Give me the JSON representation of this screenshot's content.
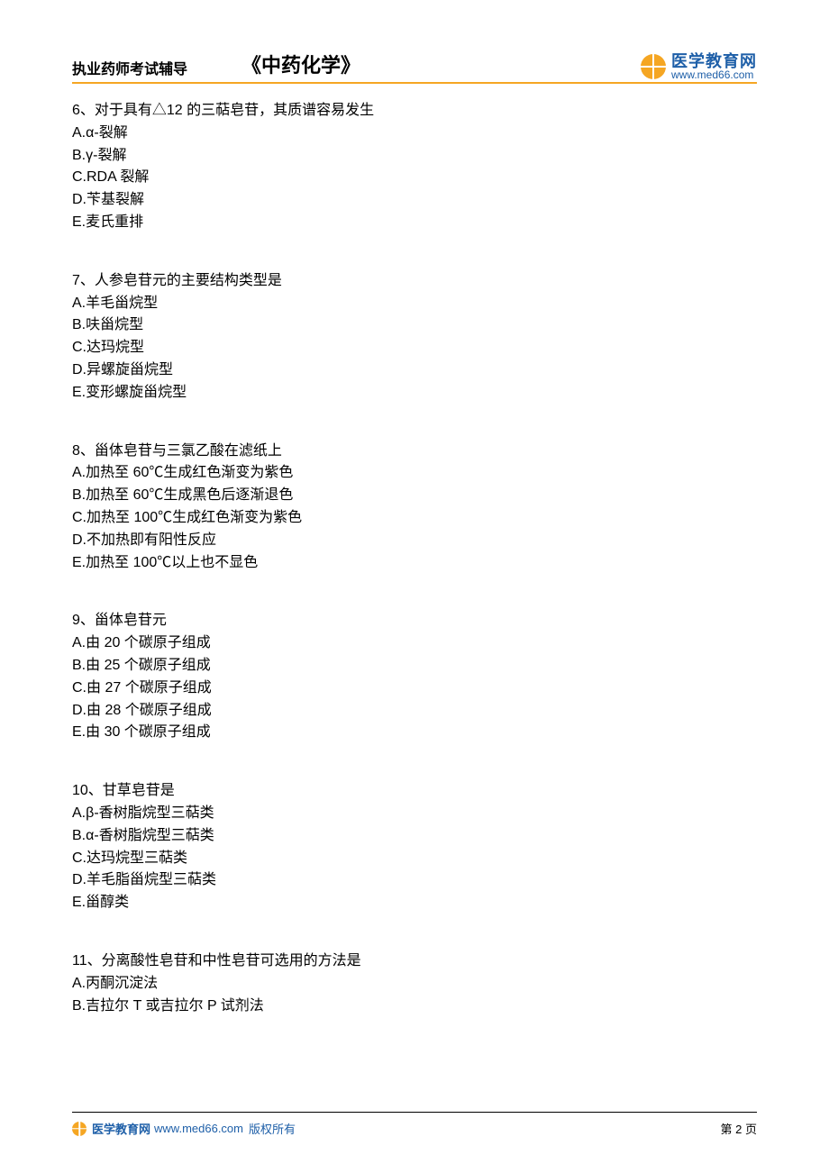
{
  "header": {
    "left": "执业药师考试辅导",
    "center": "《中药化学》",
    "logo_cn": "医学教育网",
    "logo_url": "www.med66.com"
  },
  "questions": [
    {
      "stem": "6、对于具有△12 的三萜皂苷，其质谱容易发生",
      "options": [
        "A.α-裂解",
        "B.γ-裂解",
        "C.RDA 裂解",
        "D.苄基裂解",
        "E.麦氏重排"
      ]
    },
    {
      "stem": "7、人参皂苷元的主要结构类型是",
      "options": [
        "A.羊毛甾烷型",
        "B.呋甾烷型",
        "C.达玛烷型",
        "D.异螺旋甾烷型",
        "E.变形螺旋甾烷型"
      ]
    },
    {
      "stem": "8、甾体皂苷与三氯乙酸在滤纸上",
      "options": [
        "A.加热至 60℃生成红色渐变为紫色",
        "B.加热至 60℃生成黑色后逐渐退色",
        "C.加热至 100℃生成红色渐变为紫色",
        "D.不加热即有阳性反应",
        "E.加热至 100℃以上也不显色"
      ]
    },
    {
      "stem": "9、甾体皂苷元",
      "options": [
        "A.由 20 个碳原子组成",
        "B.由 25 个碳原子组成",
        "C.由 27 个碳原子组成",
        "D.由 28 个碳原子组成",
        "E.由 30 个碳原子组成"
      ]
    },
    {
      "stem": "10、甘草皂苷是",
      "options": [
        "A.β-香树脂烷型三萜类",
        "B.α-香树脂烷型三萜类",
        "C.达玛烷型三萜类",
        "D.羊毛脂甾烷型三萜类",
        "E.甾醇类"
      ]
    },
    {
      "stem": "11、分离酸性皂苷和中性皂苷可选用的方法是",
      "options": [
        "A.丙酮沉淀法",
        "B.吉拉尔 T 或吉拉尔 P 试剂法"
      ]
    }
  ],
  "footer": {
    "brand": "医学教育网",
    "url": "www.med66.com",
    "copyright": "版权所有",
    "page": "第 2 页"
  }
}
